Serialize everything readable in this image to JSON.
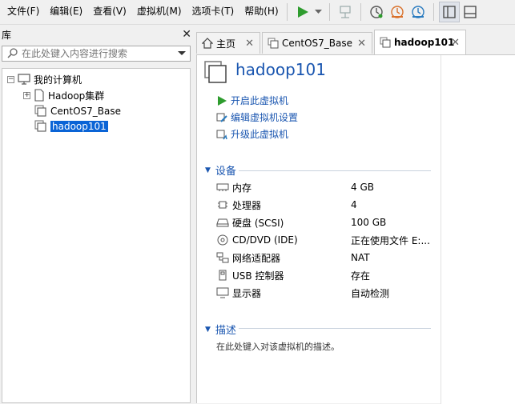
{
  "menubar": {
    "items": [
      "文件(F)",
      "编辑(E)",
      "查看(V)",
      "虚拟机(M)",
      "选项卡(T)",
      "帮助(H)"
    ]
  },
  "library": {
    "title": "库",
    "search_placeholder": "在此处键入内容进行搜索",
    "tree": {
      "root": "我的计算机",
      "children": [
        "Hadoop集群",
        "CentOS7_Base",
        "hadoop101"
      ],
      "selected": "hadoop101"
    }
  },
  "tabs": [
    {
      "label": "主页"
    },
    {
      "label": "CentOS7_Base"
    },
    {
      "label": "hadoop101",
      "active": true
    }
  ],
  "vm": {
    "name": "hadoop101",
    "actions": [
      "开启此虚拟机",
      "编辑虚拟机设置",
      "升级此虚拟机"
    ],
    "devices_title": "设备",
    "devices": [
      {
        "icon": "memory-icon",
        "name": "内存",
        "value": "4 GB"
      },
      {
        "icon": "cpu-icon",
        "name": "处理器",
        "value": "4"
      },
      {
        "icon": "hdd-icon",
        "name": "硬盘 (SCSI)",
        "value": "100 GB"
      },
      {
        "icon": "cd-icon",
        "name": "CD/DVD (IDE)",
        "value": "正在使用文件 E:..."
      },
      {
        "icon": "network-icon",
        "name": "网络适配器",
        "value": "NAT"
      },
      {
        "icon": "usb-icon",
        "name": "USB 控制器",
        "value": "存在"
      },
      {
        "icon": "display-icon",
        "name": "显示器",
        "value": "自动检测"
      }
    ],
    "description_title": "描述",
    "description_placeholder": "在此处键入对该虚拟机的描述。"
  },
  "colors": {
    "accent": "#1a56b0",
    "play": "#2e9c2e",
    "selection": "#0a64d6"
  }
}
